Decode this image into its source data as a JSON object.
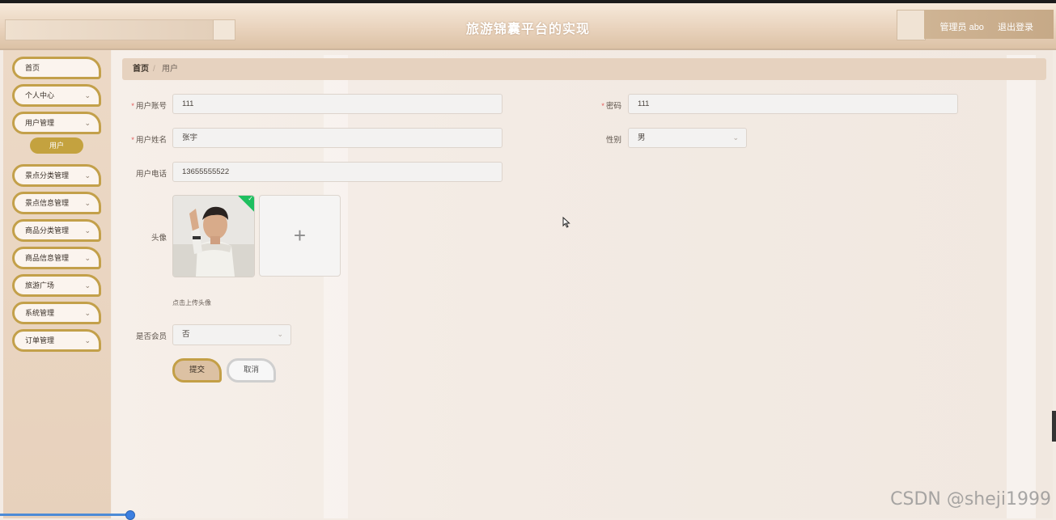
{
  "header": {
    "title": "旅游锦囊平台的实现",
    "user_label": "管理员 abo",
    "logout_label": "退出登录"
  },
  "sidebar": {
    "items": [
      {
        "label": "首页",
        "chevron": ""
      },
      {
        "label": "个人中心",
        "chevron": "⌄"
      },
      {
        "label": "用户管理",
        "chevron": "⌄"
      },
      {
        "label": "景点分类管理",
        "chevron": "⌄"
      },
      {
        "label": "景点信息管理",
        "chevron": "⌄"
      },
      {
        "label": "商品分类管理",
        "chevron": "⌄"
      },
      {
        "label": "商品信息管理",
        "chevron": "⌄"
      },
      {
        "label": "旅游广场",
        "chevron": "⌄"
      },
      {
        "label": "系统管理",
        "chevron": "⌄"
      },
      {
        "label": "订单管理",
        "chevron": "⌄"
      }
    ],
    "active_sub": "用户"
  },
  "breadcrumb": {
    "home": "首页",
    "separator": "/",
    "current": "用户"
  },
  "form": {
    "account_label": "用户账号",
    "account_value": "111",
    "password_label": "密码",
    "password_value": "111",
    "name_label": "用户姓名",
    "name_value": "张宇",
    "gender_label": "性别",
    "gender_value": "男",
    "phone_label": "用户电话",
    "phone_value": "13655555522",
    "avatar_label": "头像",
    "upload_plus": "+",
    "upload_hint": "点击上传头像",
    "member_label": "是否会员",
    "member_value": "否",
    "required_mark": "*",
    "select_caret": "⌄",
    "upload_success_mark": "✓"
  },
  "buttons": {
    "submit": "提交",
    "cancel": "取消"
  },
  "watermark": "CSDN @sheji1999",
  "colors": {
    "accent_gold": "#c3a04a",
    "submenu_active": "#c4a23f",
    "required": "#e25d5d",
    "upload_success": "#1fbf5f"
  }
}
